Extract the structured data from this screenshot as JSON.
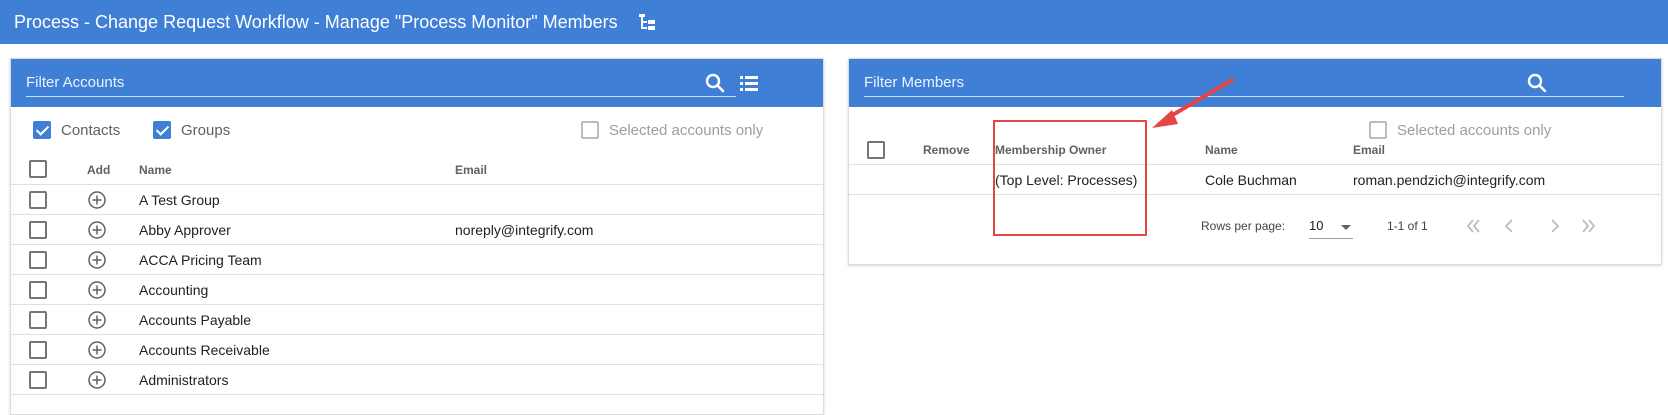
{
  "header": {
    "title": "Process - Change Request Workflow - Manage \"Process Monitor\" Members",
    "icon": "tree-structure-icon"
  },
  "accounts_panel": {
    "filter_placeholder": "Filter Accounts",
    "options": {
      "contacts_label": "Contacts",
      "contacts_checked": true,
      "groups_label": "Groups",
      "groups_checked": true,
      "selected_only_label": "Selected accounts only",
      "selected_only_checked": false
    },
    "columns": {
      "add": "Add",
      "name": "Name",
      "email": "Email"
    },
    "rows": [
      {
        "name": "A Test Group",
        "email": ""
      },
      {
        "name": "Abby Approver",
        "email": "noreply@integrify.com"
      },
      {
        "name": "ACCA Pricing Team",
        "email": ""
      },
      {
        "name": "Accounting",
        "email": ""
      },
      {
        "name": "Accounts Payable",
        "email": ""
      },
      {
        "name": "Accounts Receivable",
        "email": ""
      },
      {
        "name": "Administrators",
        "email": ""
      }
    ]
  },
  "members_panel": {
    "filter_placeholder": "Filter Members",
    "selected_only_label": "Selected accounts only",
    "columns": {
      "remove": "Remove",
      "owner": "Membership Owner",
      "name": "Name",
      "email": "Email"
    },
    "rows": [
      {
        "owner": "(Top Level: Processes)",
        "name": "Cole Buchman",
        "email": "roman.pendzich@integrify.com"
      }
    ],
    "pagination": {
      "rows_per_page_label": "Rows per page:",
      "rows_per_page_value": "10",
      "range_text": "1-1 of 1"
    }
  },
  "colors": {
    "primary": "#3f7fd6",
    "annotation": "#e64545"
  }
}
